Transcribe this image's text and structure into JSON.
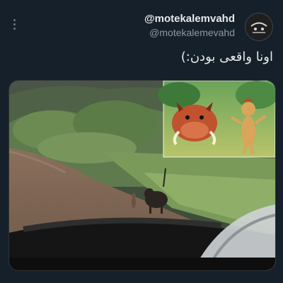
{
  "tweet": {
    "display_name": "@motekalemvahd",
    "handle": "@motekalemevahd",
    "text": "اونا واقعی بودن:)",
    "more_icon": "more-vertical-icon",
    "avatar_icon": "avatar-logo"
  },
  "media": {
    "kind": "photo",
    "description_icon": "lion-king-meme-photo"
  },
  "colors": {
    "background": "#15202b",
    "text_primary": "#e7e9ea",
    "text_secondary": "#8b98a5"
  }
}
